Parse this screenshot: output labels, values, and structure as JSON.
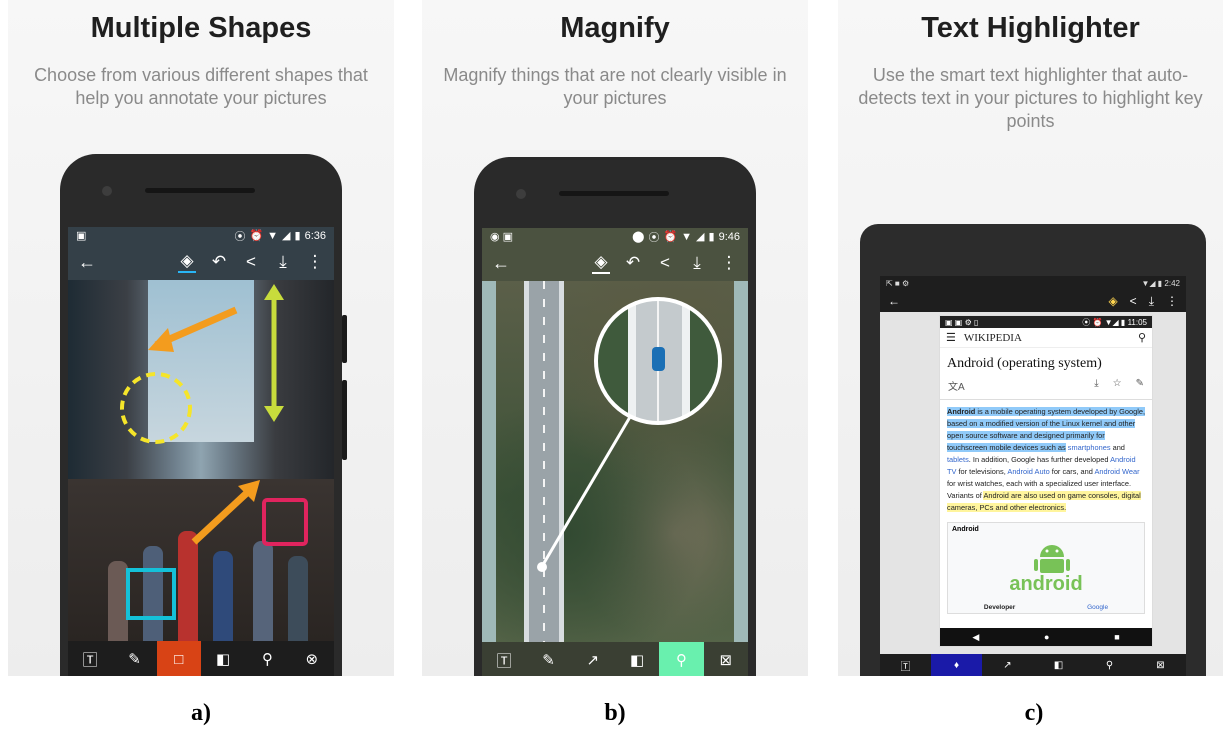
{
  "panels": [
    {
      "title": "Multiple Shapes",
      "subtitle": "Choose from various different shapes that help you annotate your pictures",
      "caption": "a)",
      "status_time": "6:36",
      "tools": [
        "T",
        "pencil",
        "rectangle",
        "mask",
        "magnify",
        "blur"
      ],
      "active_tool": "rectangle"
    },
    {
      "title": "Magnify",
      "subtitle": "Magnify things that are not clearly visible in your pictures",
      "caption": "b)",
      "status_time": "9:46",
      "tools": [
        "T",
        "pencil",
        "arrow",
        "mask",
        "magnify",
        "blur"
      ],
      "active_tool": "magnify"
    },
    {
      "title": "Text Highlighter",
      "subtitle": "Use the smart text highlighter that auto-detects text in your pictures to highlight key points",
      "caption": "c)",
      "status_time": "2:42",
      "tools": [
        "T",
        "highlighter",
        "arrow",
        "mask",
        "magnify",
        "blur"
      ],
      "active_tool": "highlighter"
    }
  ],
  "wiki": {
    "status_time": "11:05",
    "logo": "WIKIPEDIA",
    "title": "Android (operating system)",
    "para1_bold": "Android",
    "para1_hl": " is a mobile operating system developed by Google, based on a modified version of the Linux kernel and other open source software and designed primarily for touchscreen mobile devices such as",
    "para1_smart": "smartphones",
    "para1_and": " and ",
    "para1_tablets": "tablets",
    "para1_rest1": ". In addition, Google has further developed ",
    "para1_tv": "Android TV",
    "para1_rest2": " for televisions, ",
    "para1_auto": "Android Auto",
    "para1_rest3": " for cars, and ",
    "para1_wear": "Android Wear",
    "para1_rest4": " for wrist watches, each with a specialized user interface. Variants of ",
    "para1_yellow": "Android are also used on game consoles, digital cameras, PCs and other electronics.",
    "infobox_title": "Android",
    "logo_word": "android",
    "dev_label": "Developer",
    "dev_value": "Google"
  },
  "colors": {
    "active_red": "#d84315",
    "active_green": "#69f0ae",
    "active_blue": "#1a1aa8",
    "arrow_orange": "#f39c1e",
    "arrow_green": "#c8dc3c",
    "circle_yellow": "#f5e52a",
    "rect_pink": "#e0245e",
    "rect_cyan": "#14c1d9"
  }
}
